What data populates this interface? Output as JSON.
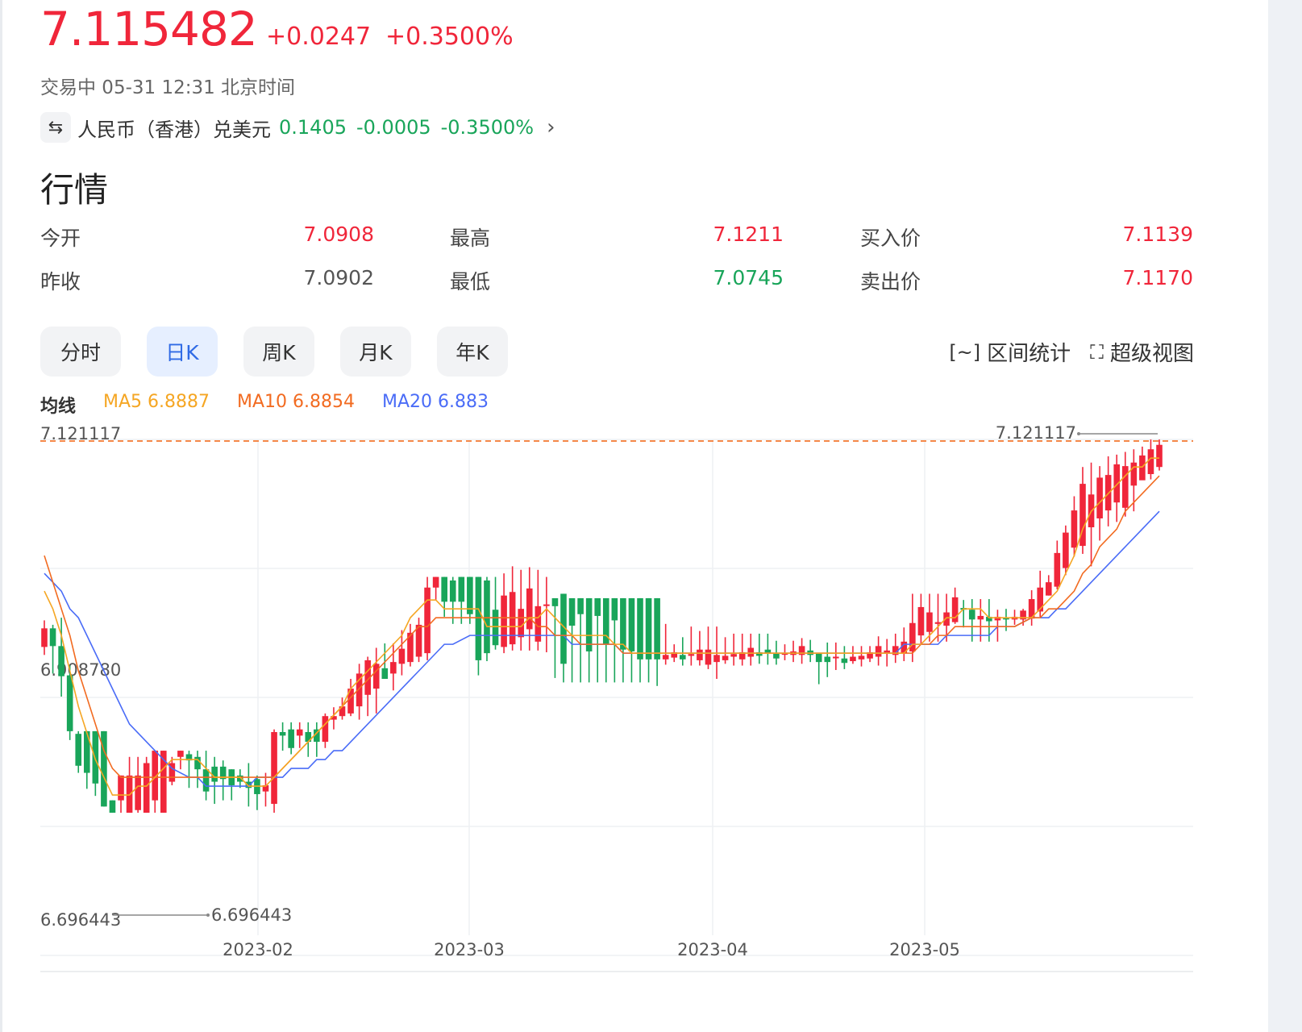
{
  "quote": {
    "price": "7.115482",
    "change": "+0.0247",
    "change_pct": "+0.3500%",
    "status": "交易中 05-31 12:31 北京时间"
  },
  "related": {
    "icon": "swap-arrows-icon",
    "name": "人民币（香港）兑美元",
    "value": "0.1405",
    "change": "-0.0005",
    "change_pct": "-0.3500%",
    "arrow": "›"
  },
  "section_title": "行情",
  "stats": {
    "open_label": "今开",
    "open_value": "7.0908",
    "high_label": "最高",
    "high_value": "7.1211",
    "bid_label": "买入价",
    "bid_value": "7.1139",
    "prev_close_label": "昨收",
    "prev_close_value": "7.0902",
    "low_label": "最低",
    "low_value": "7.0745",
    "ask_label": "卖出价",
    "ask_value": "7.1170"
  },
  "tabs": [
    "分时",
    "日K",
    "周K",
    "月K",
    "年K"
  ],
  "active_tab": "日K",
  "tools": {
    "range_stats": "区间统计",
    "super_view": "超级视图"
  },
  "ma": {
    "label": "均线",
    "ma5": "MA5 6.8887",
    "ma10": "MA10 6.8854",
    "ma20": "MA20 6.883"
  },
  "colors": {
    "up": "#f0263a",
    "down": "#19a55a",
    "ma5": "#f5a623",
    "ma10": "#f26b21",
    "ma20": "#4a6cf7",
    "accent": "#2f6ae5"
  },
  "chart_data": {
    "type": "candlestick",
    "ylim": [
      6.696443,
      7.121117
    ],
    "y_ticks": [
      "7.121117",
      "6.908780",
      "6.696443"
    ],
    "x_ticks": [
      "2023-02",
      "2023-03",
      "2023-04",
      "2023-05"
    ],
    "max_label": "7.121117",
    "min_label": "6.696443",
    "reference_line": 7.121117,
    "candles": [
      [
        6.887,
        6.908,
        6.917,
        6.878
      ],
      [
        6.908,
        6.888,
        6.912,
        6.857
      ],
      [
        6.888,
        6.854,
        6.92,
        6.831
      ],
      [
        6.855,
        6.792,
        6.866,
        6.782
      ],
      [
        6.789,
        6.753,
        6.792,
        6.745
      ],
      [
        6.792,
        6.745,
        6.792,
        6.727
      ],
      [
        6.792,
        6.733,
        6.792,
        6.719
      ],
      [
        6.792,
        6.707,
        6.792,
        6.707
      ],
      [
        6.714,
        6.7,
        6.714,
        6.7
      ],
      [
        6.714,
        6.742,
        6.742,
        6.7
      ],
      [
        6.7,
        6.742,
        6.763,
        6.7
      ],
      [
        6.703,
        6.742,
        6.763,
        6.7
      ],
      [
        6.7,
        6.756,
        6.763,
        6.7
      ],
      [
        6.714,
        6.77,
        6.77,
        6.7
      ],
      [
        6.7,
        6.77,
        6.77,
        6.7
      ],
      [
        6.735,
        6.756,
        6.763,
        6.731
      ],
      [
        6.763,
        6.77,
        6.77,
        6.749
      ],
      [
        6.766,
        6.759,
        6.77,
        6.728
      ],
      [
        6.763,
        6.749,
        6.77,
        6.728
      ],
      [
        6.749,
        6.724,
        6.77,
        6.714
      ],
      [
        6.752,
        6.735,
        6.763,
        6.71
      ],
      [
        6.752,
        6.738,
        6.759,
        6.714
      ],
      [
        6.749,
        6.731,
        6.749,
        6.714
      ],
      [
        6.742,
        6.735,
        6.749,
        6.728
      ],
      [
        6.735,
        6.728,
        6.756,
        6.707
      ],
      [
        6.738,
        6.721,
        6.742,
        6.703
      ],
      [
        6.724,
        6.731,
        6.745,
        6.707
      ],
      [
        6.71,
        6.791,
        6.794,
        6.7
      ],
      [
        6.791,
        6.787,
        6.802,
        6.77
      ],
      [
        6.794,
        6.773,
        6.802,
        6.766
      ],
      [
        6.787,
        6.794,
        6.802,
        6.773
      ],
      [
        6.791,
        6.78,
        6.802,
        6.763
      ],
      [
        6.794,
        6.78,
        6.802,
        6.763
      ],
      [
        6.78,
        6.809,
        6.812,
        6.773
      ],
      [
        6.805,
        6.809,
        6.819,
        6.794
      ],
      [
        6.809,
        6.82,
        6.83,
        6.805
      ],
      [
        6.812,
        6.84,
        6.851,
        6.809
      ],
      [
        6.82,
        6.857,
        6.868,
        6.805
      ],
      [
        6.833,
        6.872,
        6.876,
        6.809
      ],
      [
        6.84,
        6.868,
        6.886,
        6.812
      ],
      [
        6.863,
        6.851,
        6.891,
        6.855
      ],
      [
        6.857,
        6.87,
        6.891,
        6.838
      ],
      [
        6.868,
        6.885,
        6.906,
        6.855
      ],
      [
        6.87,
        6.903,
        6.913,
        6.865
      ],
      [
        6.876,
        6.912,
        6.92,
        6.87
      ],
      [
        6.88,
        6.954,
        6.966,
        6.872
      ],
      [
        6.954,
        6.966,
        6.966,
        6.94
      ],
      [
        6.966,
        6.938,
        6.966,
        6.921
      ],
      [
        6.962,
        6.938,
        6.966,
        6.913
      ],
      [
        6.966,
        6.938,
        6.966,
        6.913
      ],
      [
        6.966,
        6.924,
        6.966,
        6.913
      ],
      [
        6.966,
        6.872,
        6.966,
        6.855
      ],
      [
        6.962,
        6.88,
        6.966,
        6.871
      ],
      [
        6.929,
        6.889,
        6.966,
        6.884
      ],
      [
        6.887,
        6.945,
        6.97,
        6.88
      ],
      [
        6.89,
        6.949,
        6.978,
        6.883
      ],
      [
        6.898,
        6.93,
        6.974,
        6.883
      ],
      [
        6.907,
        6.953,
        6.977,
        6.883
      ],
      [
        6.893,
        6.933,
        6.974,
        6.883
      ],
      [
        6.934,
        6.935,
        6.966,
        6.881
      ],
      [
        6.942,
        6.933,
        6.94,
        6.852
      ],
      [
        6.947,
        6.868,
        6.947,
        6.847
      ],
      [
        6.942,
        6.911,
        6.942,
        6.847
      ],
      [
        6.942,
        6.924,
        6.942,
        6.847
      ],
      [
        6.942,
        6.882,
        6.942,
        6.847
      ],
      [
        6.942,
        6.922,
        6.942,
        6.847
      ],
      [
        6.942,
        6.89,
        6.942,
        6.847
      ],
      [
        6.942,
        6.917,
        6.942,
        6.847
      ],
      [
        6.942,
        6.884,
        6.942,
        6.847
      ],
      [
        6.942,
        6.882,
        6.942,
        6.847
      ],
      [
        6.942,
        6.873,
        6.942,
        6.847
      ],
      [
        6.942,
        6.873,
        6.942,
        6.847
      ],
      [
        6.942,
        6.873,
        6.942,
        6.843
      ],
      [
        6.873,
        6.878,
        6.913,
        6.867
      ],
      [
        6.875,
        6.881,
        6.89,
        6.87
      ],
      [
        6.878,
        6.873,
        6.898,
        6.866
      ],
      [
        6.877,
        6.879,
        6.91,
        6.866
      ],
      [
        6.872,
        6.884,
        6.905,
        6.866
      ],
      [
        6.867,
        6.884,
        6.91,
        6.862
      ],
      [
        6.87,
        6.878,
        6.91,
        6.851
      ],
      [
        6.872,
        6.877,
        6.898,
        6.868
      ],
      [
        6.876,
        6.879,
        6.902,
        6.866
      ],
      [
        6.873,
        6.881,
        6.902,
        6.866
      ],
      [
        6.876,
        6.886,
        6.902,
        6.866
      ],
      [
        6.881,
        6.877,
        6.902,
        6.868
      ],
      [
        6.884,
        6.88,
        6.902,
        6.867
      ],
      [
        6.88,
        6.874,
        6.894,
        6.867
      ],
      [
        6.88,
        6.88,
        6.89,
        6.872
      ],
      [
        6.878,
        6.882,
        6.894,
        6.87
      ],
      [
        6.878,
        6.888,
        6.897,
        6.868
      ],
      [
        6.883,
        6.878,
        6.895,
        6.87
      ],
      [
        6.88,
        6.87,
        6.876,
        6.845
      ],
      [
        6.876,
        6.87,
        6.892,
        6.853
      ],
      [
        6.876,
        6.876,
        6.892,
        6.861
      ],
      [
        6.874,
        6.869,
        6.888,
        6.862
      ],
      [
        6.871,
        6.876,
        6.888,
        6.868
      ],
      [
        6.873,
        6.877,
        6.888,
        6.865
      ],
      [
        6.874,
        6.881,
        6.888,
        6.87
      ],
      [
        6.876,
        6.888,
        6.899,
        6.866
      ],
      [
        6.88,
        6.883,
        6.896,
        6.865
      ],
      [
        6.878,
        6.888,
        6.902,
        6.869
      ],
      [
        6.88,
        6.893,
        6.909,
        6.871
      ],
      [
        6.882,
        6.914,
        6.947,
        6.87
      ],
      [
        6.9,
        6.932,
        6.947,
        6.89
      ],
      [
        6.904,
        6.926,
        6.947,
        6.893
      ],
      [
        6.913,
        6.915,
        6.947,
        6.893
      ],
      [
        6.911,
        6.926,
        6.947,
        6.893
      ],
      [
        6.915,
        6.943,
        6.954,
        6.913
      ],
      [
        6.931,
        6.929,
        6.94,
        6.909
      ],
      [
        6.929,
        6.918,
        6.941,
        6.893
      ],
      [
        6.918,
        6.922,
        6.941,
        6.893
      ],
      [
        6.921,
        6.916,
        6.941,
        6.893
      ],
      [
        6.917,
        6.921,
        6.929,
        6.893
      ],
      [
        6.92,
        6.918,
        6.93,
        6.905
      ],
      [
        6.918,
        6.921,
        6.929,
        6.912
      ],
      [
        6.918,
        6.928,
        6.93,
        6.911
      ],
      [
        6.919,
        6.941,
        6.951,
        6.911
      ],
      [
        6.927,
        6.954,
        6.973,
        6.921
      ],
      [
        6.945,
        6.96,
        6.968,
        6.945
      ],
      [
        6.955,
        6.993,
        7.007,
        6.952
      ],
      [
        6.976,
        7.016,
        7.024,
        6.968
      ],
      [
        6.999,
        7.041,
        7.057,
        6.989
      ],
      [
        7.001,
        7.071,
        7.09,
        6.992
      ],
      [
        7.022,
        7.059,
        7.095,
        6.978
      ],
      [
        7.032,
        7.078,
        7.091,
        7.007
      ],
      [
        7.041,
        7.081,
        7.102,
        7.023
      ],
      [
        7.05,
        7.093,
        7.104,
        7.028
      ],
      [
        7.044,
        7.091,
        7.107,
        7.034
      ],
      [
        7.069,
        7.095,
        7.11,
        7.04
      ],
      [
        7.075,
        7.103,
        7.113,
        7.077
      ],
      [
        7.082,
        7.11,
        7.121,
        7.076
      ],
      [
        7.09,
        7.115,
        7.121,
        7.086
      ]
    ],
    "ma5": [
      6.95,
      6.93,
      6.9,
      6.86,
      6.82,
      6.79,
      6.76,
      6.74,
      6.72,
      6.72,
      6.72,
      6.73,
      6.73,
      6.74,
      6.75,
      6.76,
      6.76,
      6.76,
      6.75,
      6.74,
      6.74,
      6.74,
      6.74,
      6.73,
      6.73,
      6.73,
      6.74,
      6.75,
      6.76,
      6.77,
      6.78,
      6.79,
      6.8,
      6.81,
      6.82,
      6.84,
      6.85,
      6.86,
      6.87,
      6.88,
      6.89,
      6.9,
      6.92,
      6.93,
      6.94,
      6.94,
      6.93,
      6.93,
      6.93,
      6.93,
      6.91,
      6.91,
      6.91,
      6.91,
      6.91,
      6.92,
      6.92,
      6.93,
      6.92,
      6.91,
      6.9,
      6.9,
      6.9,
      6.9,
      6.9,
      6.89,
      6.89,
      6.88,
      6.88,
      6.88,
      6.88,
      6.88,
      6.88,
      6.88,
      6.88,
      6.88,
      6.88,
      6.88,
      6.88,
      6.88,
      6.88,
      6.88,
      6.88,
      6.88,
      6.88,
      6.88,
      6.88,
      6.88,
      6.88,
      6.88,
      6.88,
      6.88,
      6.88,
      6.88,
      6.88,
      6.88,
      6.88,
      6.88,
      6.88,
      6.89,
      6.89,
      6.9,
      6.91,
      6.92,
      6.92,
      6.93,
      6.93,
      6.93,
      6.92,
      6.92,
      6.92,
      6.92,
      6.92,
      6.93,
      6.94,
      6.95,
      6.97,
      6.99,
      7.02,
      7.04,
      7.05,
      7.06,
      7.07,
      7.08,
      7.09,
      7.09,
      7.1,
      7.1
    ],
    "ma10": [
      6.99,
      6.96,
      6.93,
      6.9,
      6.86,
      6.83,
      6.8,
      6.77,
      6.75,
      6.74,
      6.74,
      6.74,
      6.74,
      6.74,
      6.74,
      6.74,
      6.74,
      6.74,
      6.74,
      6.74,
      6.74,
      6.74,
      6.74,
      6.74,
      6.74,
      6.74,
      6.74,
      6.75,
      6.76,
      6.77,
      6.78,
      6.79,
      6.8,
      6.81,
      6.82,
      6.83,
      6.84,
      6.85,
      6.86,
      6.87,
      6.88,
      6.89,
      6.9,
      6.91,
      6.91,
      6.92,
      6.92,
      6.92,
      6.92,
      6.92,
      6.92,
      6.92,
      6.92,
      6.92,
      6.92,
      6.92,
      6.91,
      6.91,
      6.9,
      6.9,
      6.9,
      6.89,
      6.89,
      6.89,
      6.89,
      6.89,
      6.88,
      6.88,
      6.88,
      6.88,
      6.88,
      6.88,
      6.88,
      6.88,
      6.88,
      6.88,
      6.88,
      6.88,
      6.88,
      6.88,
      6.88,
      6.88,
      6.88,
      6.88,
      6.88,
      6.88,
      6.88,
      6.88,
      6.88,
      6.88,
      6.88,
      6.88,
      6.88,
      6.88,
      6.88,
      6.88,
      6.88,
      6.88,
      6.88,
      6.88,
      6.89,
      6.89,
      6.9,
      6.9,
      6.91,
      6.91,
      6.91,
      6.91,
      6.91,
      6.91,
      6.91,
      6.91,
      6.92,
      6.92,
      6.93,
      6.93,
      6.94,
      6.95,
      6.97,
      6.98,
      7.0,
      7.01,
      7.02,
      7.04,
      7.05,
      7.06,
      7.07,
      7.08
    ],
    "ma20": [
      6.97,
      6.96,
      6.95,
      6.93,
      6.92,
      6.9,
      6.88,
      6.86,
      6.84,
      6.82,
      6.8,
      6.79,
      6.78,
      6.77,
      6.76,
      6.75,
      6.74,
      6.74,
      6.73,
      6.73,
      6.73,
      6.73,
      6.73,
      6.73,
      6.74,
      6.74,
      6.74,
      6.74,
      6.75,
      6.75,
      6.75,
      6.76,
      6.76,
      6.77,
      6.77,
      6.78,
      6.79,
      6.8,
      6.81,
      6.82,
      6.83,
      6.84,
      6.85,
      6.86,
      6.87,
      6.88,
      6.89,
      6.89,
      6.9,
      6.9,
      6.9,
      6.9,
      6.9,
      6.9,
      6.9,
      6.9,
      6.9,
      6.9,
      6.9,
      6.9,
      6.89,
      6.89,
      6.89,
      6.89,
      6.89,
      6.89,
      6.88,
      6.88,
      6.88,
      6.88,
      6.88,
      6.88,
      6.88,
      6.88,
      6.88,
      6.88,
      6.88,
      6.88,
      6.88,
      6.88,
      6.88,
      6.88,
      6.88,
      6.88,
      6.88,
      6.88,
      6.88,
      6.88,
      6.88,
      6.88,
      6.88,
      6.88,
      6.88,
      6.88,
      6.88,
      6.88,
      6.88,
      6.88,
      6.89,
      6.89,
      6.89,
      6.89,
      6.89,
      6.9,
      6.9,
      6.9,
      6.9,
      6.9,
      6.9,
      6.91,
      6.91,
      6.91,
      6.92,
      6.92,
      6.92,
      6.93,
      6.93,
      6.94,
      6.95,
      6.96,
      6.97,
      6.98,
      6.99,
      7.0,
      7.01,
      7.02,
      7.03,
      7.04
    ]
  }
}
